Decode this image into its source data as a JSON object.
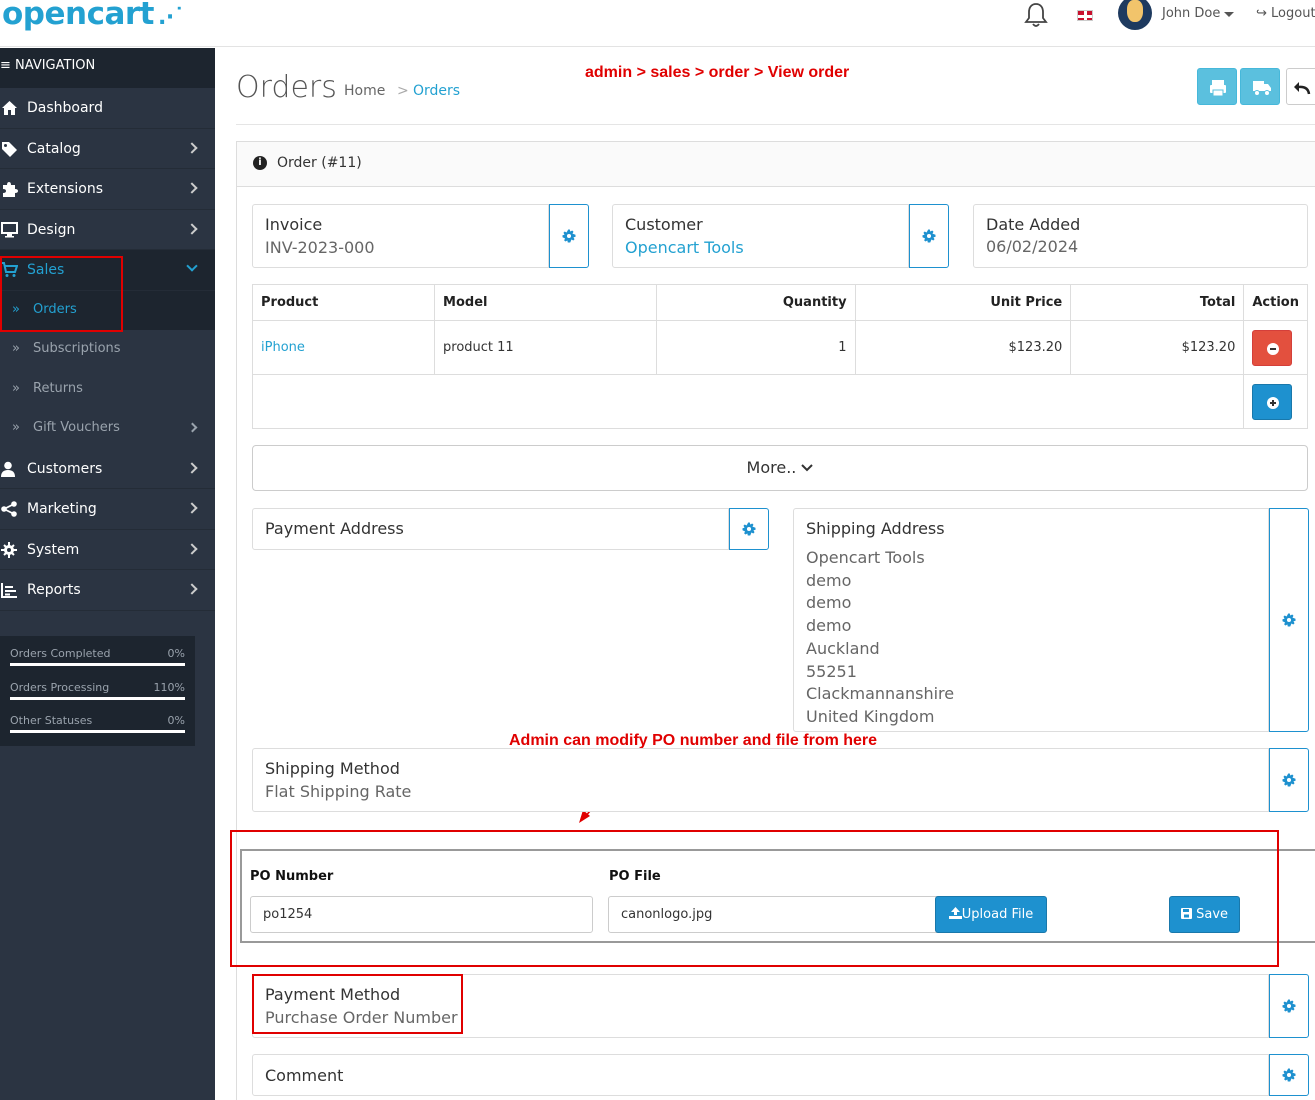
{
  "header": {
    "logo": "opencart",
    "user_name": "John Doe",
    "logout_label": "Logout"
  },
  "sidebar": {
    "nav_title": "NAVIGATION",
    "items": [
      {
        "label": "Dashboard",
        "icon": "home-icon"
      },
      {
        "label": "Catalog",
        "icon": "tag-icon"
      },
      {
        "label": "Extensions",
        "icon": "puzzle-icon"
      },
      {
        "label": "Design",
        "icon": "desktop-icon"
      },
      {
        "label": "Sales",
        "icon": "cart-icon"
      },
      {
        "label": "Customers",
        "icon": "user-icon"
      },
      {
        "label": "Marketing",
        "icon": "share-icon"
      },
      {
        "label": "System",
        "icon": "gear-icon"
      },
      {
        "label": "Reports",
        "icon": "bar-chart-icon"
      }
    ],
    "sales_sub": [
      {
        "label": "Orders"
      },
      {
        "label": "Subscriptions"
      },
      {
        "label": "Returns"
      },
      {
        "label": "Gift Vouchers"
      }
    ],
    "stats": [
      {
        "label": "Orders Completed",
        "value": "0%",
        "fraction": 1.0
      },
      {
        "label": "Orders Processing",
        "value": "110%",
        "fraction": 1.0
      },
      {
        "label": "Other Statuses",
        "value": "0%",
        "fraction": 1.0
      }
    ]
  },
  "page": {
    "title": "Orders",
    "breadcrumb_home": "Home",
    "breadcrumb_sep": ">",
    "breadcrumb_current": "Orders",
    "panel_title": "Order (#11)"
  },
  "annotations": {
    "path": "admin > sales > order > View order",
    "po_note": "Admin can modify PO number and file from here",
    "color": "#e00000"
  },
  "order": {
    "invoice_label": "Invoice",
    "invoice_value": "INV-2023-000",
    "customer_label": "Customer",
    "customer_value": "Opencart Tools",
    "date_label": "Date Added",
    "date_value": "06/02/2024"
  },
  "products": {
    "headers": [
      "Product",
      "Model",
      "Quantity",
      "Unit Price",
      "Total",
      "Action"
    ],
    "rows": [
      {
        "product": "iPhone",
        "model": "product 11",
        "quantity": "1",
        "unit_price": "$123.20",
        "total": "$123.20"
      }
    ]
  },
  "more_label": "More..",
  "payment_address": {
    "label": "Payment Address"
  },
  "shipping_address": {
    "label": "Shipping Address",
    "lines": [
      "Opencart Tools",
      "demo",
      "demo",
      "demo",
      "Auckland",
      "55251",
      "Clackmannanshire",
      "United Kingdom"
    ]
  },
  "shipping_method": {
    "label": "Shipping Method",
    "value": "Flat Shipping Rate"
  },
  "po": {
    "number_label": "PO Number",
    "number_value": "po1254",
    "file_label": "PO File",
    "file_value": "canonlogo.jpg",
    "upload_label": "Upload File",
    "save_label": "Save"
  },
  "payment_method": {
    "label": "Payment Method",
    "value": "Purchase Order Number"
  },
  "comment": {
    "label": "Comment"
  },
  "colors": {
    "brand": "#23a1d1",
    "sidebar_bg": "#2b3442",
    "button_primary": "#1e91cf",
    "button_info": "#5bc0de",
    "button_danger": "#e3503e"
  }
}
